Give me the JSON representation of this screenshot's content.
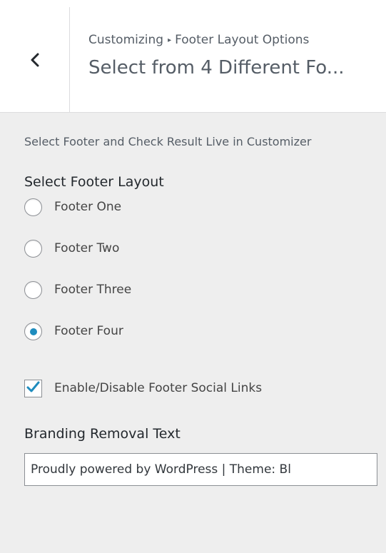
{
  "header": {
    "breadcrumb_root": "Customizing",
    "breadcrumb_separator": "▸",
    "breadcrumb_panel": "Footer Layout Options",
    "section_title": "Select from 4 Different Fo..."
  },
  "description": "Select Footer and Check Result Live in Customizer",
  "footer_layout": {
    "title": "Select Footer Layout",
    "options": [
      {
        "label": "Footer One",
        "selected": false
      },
      {
        "label": "Footer Two",
        "selected": false
      },
      {
        "label": "Footer Three",
        "selected": false
      },
      {
        "label": "Footer Four",
        "selected": true
      }
    ]
  },
  "social_links": {
    "label": "Enable/Disable Footer Social Links",
    "checked": true
  },
  "branding": {
    "title": "Branding Removal Text",
    "value": "Proudly powered by WordPress | Theme: Bl"
  },
  "colors": {
    "accent": "#1e8cbe",
    "panel_bg": "#eeeeee",
    "header_bg": "#ffffff"
  },
  "icons": {
    "back": "chevron-left-icon",
    "check": "checkmark-icon"
  }
}
